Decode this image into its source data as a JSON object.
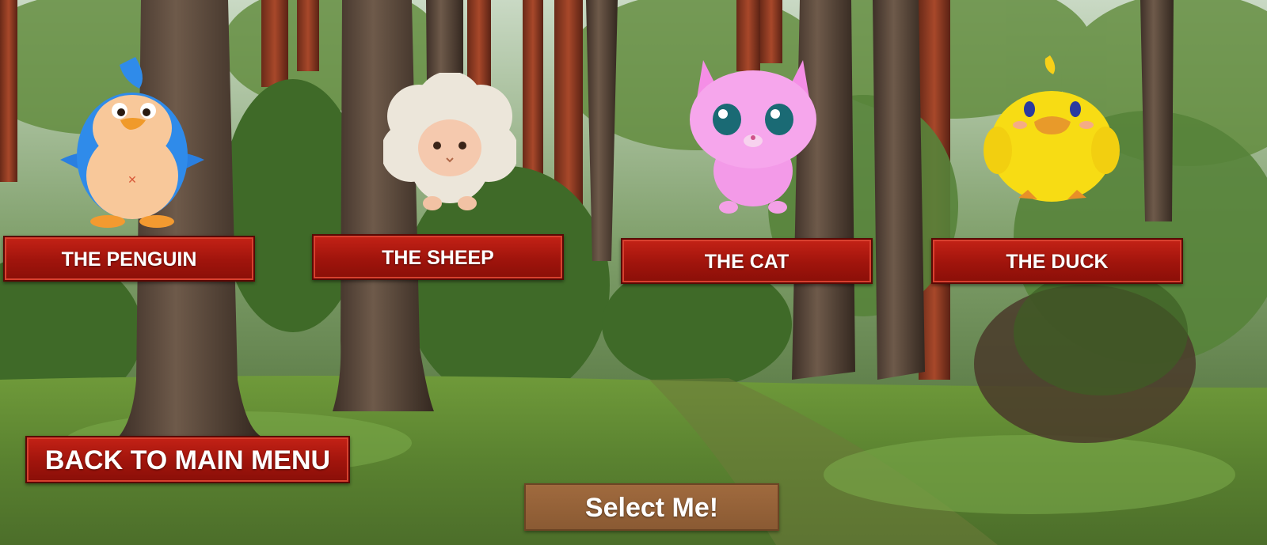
{
  "animals": [
    {
      "id": "penguin",
      "label": "THE PENGUIN"
    },
    {
      "id": "sheep",
      "label": "THE SHEEP"
    },
    {
      "id": "cat",
      "label": "THE CAT"
    },
    {
      "id": "duck",
      "label": "THE DUCK"
    }
  ],
  "menu": {
    "back_label": "BACK TO MAIN MENU",
    "select_label": "Select Me!"
  },
  "colors": {
    "button_red": "#a0140c",
    "button_brown": "#8a5a33",
    "forest_green": "#4f7a2a",
    "bark_brown": "#5a4636"
  },
  "icons": [
    "penguin-character",
    "sheep-character",
    "cat-character",
    "duck-character"
  ]
}
